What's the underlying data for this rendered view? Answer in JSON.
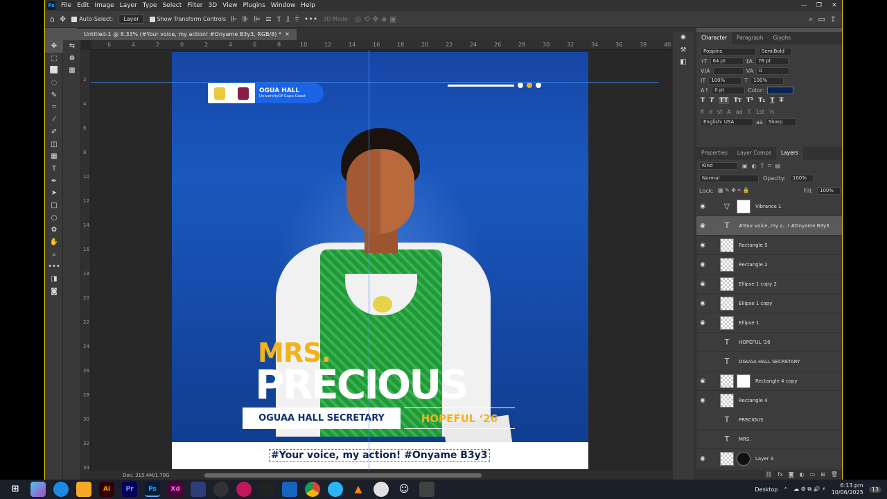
{
  "menubar": {
    "logo": "Ps",
    "items": [
      "File",
      "Edit",
      "Image",
      "Layer",
      "Type",
      "Select",
      "Filter",
      "3D",
      "View",
      "Plugins",
      "Window",
      "Help"
    ]
  },
  "options": {
    "auto_select": "Auto-Select:",
    "auto_select_value": "Layer",
    "show_transform": "Show Transform Controls",
    "mode_3d": "3D Mode:"
  },
  "document": {
    "tab_title": "Untitled-1 @ 8.33% (#Your voice, my action!   #Onyame B3y3, RGB/8) *",
    "status": "Doc: 315.4M/1.70G"
  },
  "rulers": {
    "h": [
      "6",
      "4",
      "2",
      "0",
      "2",
      "4",
      "6",
      "8",
      "10",
      "12",
      "14",
      "16",
      "18",
      "20",
      "22",
      "24",
      "26",
      "28",
      "30",
      "32",
      "34",
      "36",
      "38",
      "40"
    ],
    "v": [
      "2",
      "4",
      "6",
      "8",
      "10",
      "12",
      "14",
      "16",
      "18",
      "20",
      "22",
      "24",
      "26",
      "28",
      "30",
      "32",
      "34"
    ]
  },
  "poster": {
    "hall_name": "OGUA HALL",
    "hall_sub": "UniversityOf Cape Coast",
    "title_small": "MRS.",
    "title_big": "PRECIOUS",
    "position": "OGUAA HALL SECRETARY",
    "hopeful": "HOPEFUL ‘26",
    "hashtag": "#Your voice, my action!   #Onyame B3y3",
    "colors": {
      "gold": "#f2b21c",
      "navy": "#11306e",
      "blue": "#1b64e8"
    }
  },
  "character": {
    "tabs": [
      "Character",
      "Paragraph",
      "Glyphs"
    ],
    "font": "Poppins",
    "style": "SemiBold",
    "size": "64 pt",
    "leading": "78 pt",
    "tracking": "0",
    "vscale": "100%",
    "hscale": "100%",
    "baseline": "0 pt",
    "color_label": "Color:",
    "color": "#0b2456",
    "language": "English: USA",
    "aa": "Sharp",
    "aa_label": "aa"
  },
  "layers_panel": {
    "tabs": [
      "Properties",
      "Layer Comps",
      "Layers"
    ],
    "kind": "Kind",
    "blend": "Normal",
    "opacity_label": "Opacity:",
    "opacity": "100%",
    "lock_label": "Lock:",
    "fill_label": "Fill:",
    "fill": "100%",
    "layers": [
      {
        "name": "Vibrance 1",
        "type": "adjust"
      },
      {
        "name": "#Your voice, my a...!    #Onyame B3y3",
        "type": "text",
        "selected": true
      },
      {
        "name": "Rectangle 5",
        "type": "shape"
      },
      {
        "name": "Rectangle 2",
        "type": "shape"
      },
      {
        "name": "Ellipse 1 copy 2",
        "type": "shape"
      },
      {
        "name": "Ellipse 1 copy",
        "type": "shape"
      },
      {
        "name": "Ellipse 1",
        "type": "shape"
      },
      {
        "name": "HOPEFUL '26",
        "type": "text"
      },
      {
        "name": "OGUAA HALL SECRETARY",
        "type": "text"
      },
      {
        "name": "Rectangle 4 copy",
        "type": "shape-mask"
      },
      {
        "name": "Rectangle 4",
        "type": "shape"
      },
      {
        "name": "PRECIOUS",
        "type": "text"
      },
      {
        "name": "MRS.",
        "type": "text"
      },
      {
        "name": "Layer 3",
        "type": "image-mask"
      }
    ]
  },
  "taskbar": {
    "desktop": "Desktop",
    "time": "6:13 pm",
    "date": "10/06/2025",
    "notifications": "13",
    "apps": [
      "Ai",
      "Pr",
      "Ps",
      "Xd"
    ]
  }
}
